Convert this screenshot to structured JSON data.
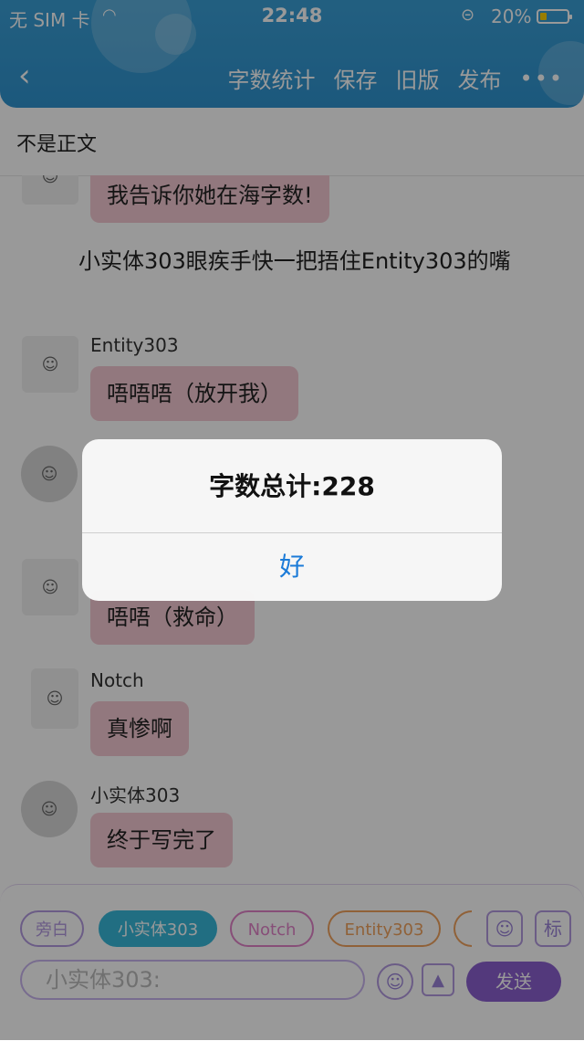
{
  "status_bar": {
    "carrier": "无 SIM 卡",
    "time": "22:48",
    "battery_percent": "20%",
    "battery_level": 0.2
  },
  "nav": {
    "back_icon": "chevron-left",
    "actions": [
      "字数统计",
      "保存",
      "旧版",
      "发布"
    ],
    "more_label": "•••"
  },
  "subheader": {
    "label": "不是正文"
  },
  "chat": {
    "messages": [
      {
        "type": "bubble",
        "text": "我告诉你她在海字数!"
      },
      {
        "type": "narration",
        "text": "小实体303眼疾手快一把捂住Entity303的嘴"
      },
      {
        "type": "bubble",
        "name": "Entity303",
        "text": "唔唔唔（放开我）"
      },
      {
        "type": "bubble",
        "text": "唔唔（救命）"
      },
      {
        "type": "bubble",
        "name": "Notch",
        "text": "真惨啊"
      },
      {
        "type": "bubble",
        "name": "小实体303",
        "text": "终于写完了"
      }
    ]
  },
  "input_bar": {
    "chips": [
      "旁白",
      "小实体303",
      "Notch",
      "Entity303"
    ],
    "tag_button": "标",
    "placeholder": "小实体303:",
    "send_label": "发送"
  },
  "alert": {
    "title": "字数总计:228",
    "ok_label": "好"
  },
  "colors": {
    "nav_bg": "#2f93cf",
    "bubble": "#f4c9d2",
    "alert_button": "#1b7bd8",
    "send_bg": "#8a5fcf"
  }
}
